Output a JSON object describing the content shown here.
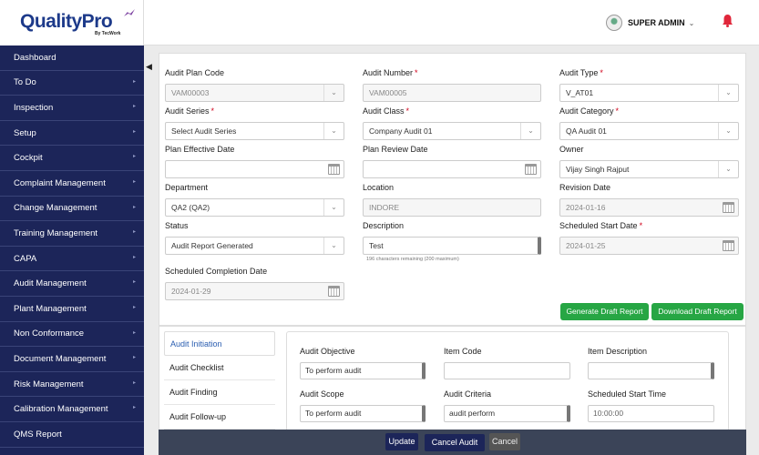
{
  "brand": {
    "name": "QualityPro",
    "tagline": "By TecWork"
  },
  "header": {
    "user": "SUPER ADMIN",
    "caret": "⌄"
  },
  "icons": {
    "bell": "bell-icon",
    "avatar": "avatar-icon",
    "collapse": "collapse-left-icon",
    "calendar": "calendar-icon",
    "chevron": "chevron-down-icon"
  },
  "colors": {
    "sidebar": "#1c2559",
    "accent": "#27a644",
    "required": "#d0021b"
  },
  "sidebar": {
    "collapse": "◀",
    "items": [
      {
        "label": "Dashboard",
        "arrow": ""
      },
      {
        "label": "To Do",
        "arrow": "▸"
      },
      {
        "label": "Inspection",
        "arrow": "▸"
      },
      {
        "label": "Setup",
        "arrow": "▸"
      },
      {
        "label": "Cockpit",
        "arrow": "▸"
      },
      {
        "label": "Complaint Management",
        "arrow": "▸"
      },
      {
        "label": "Change Management",
        "arrow": "▸"
      },
      {
        "label": "Training Management",
        "arrow": "▸"
      },
      {
        "label": "CAPA",
        "arrow": "▸"
      },
      {
        "label": "Audit Management",
        "arrow": "▸"
      },
      {
        "label": "Plant Management",
        "arrow": "▸"
      },
      {
        "label": "Non Conformance",
        "arrow": "▸"
      },
      {
        "label": "Document Management",
        "arrow": "▸"
      },
      {
        "label": "Risk Management",
        "arrow": "▸"
      },
      {
        "label": "Calibration Management",
        "arrow": "▸"
      },
      {
        "label": "QMS Report",
        "arrow": ""
      }
    ]
  },
  "form": {
    "audit_plan_code": {
      "label": "Audit Plan Code",
      "value": "VAM00003"
    },
    "audit_number": {
      "label": "Audit Number",
      "value": "VAM00005"
    },
    "audit_type": {
      "label": "Audit Type",
      "value": "V_AT01"
    },
    "audit_series": {
      "label": "Audit Series",
      "value": "Select Audit Series"
    },
    "audit_class": {
      "label": "Audit Class",
      "value": "Company Audit 01"
    },
    "audit_category": {
      "label": "Audit Category",
      "value": "QA Audit 01"
    },
    "plan_effective_date": {
      "label": "Plan Effective Date",
      "value": ""
    },
    "plan_review_date": {
      "label": "Plan Review Date",
      "value": ""
    },
    "owner": {
      "label": "Owner",
      "value": "Vijay Singh Rajput"
    },
    "department": {
      "label": "Department",
      "value": "QA2 (QA2)"
    },
    "location": {
      "label": "Location",
      "value": "INDORE"
    },
    "revision_date": {
      "label": "Revision Date",
      "value": "2024-01-16"
    },
    "status": {
      "label": "Status",
      "value": "Audit Report Generated"
    },
    "description": {
      "label": "Description",
      "value": "Test",
      "hint": "196 characters remaining (200 maximum)"
    },
    "scheduled_start_date": {
      "label": "Scheduled Start Date",
      "value": "2024-01-25"
    },
    "scheduled_completion_date": {
      "label": "Scheduled Completion Date",
      "value": "2024-01-29"
    },
    "required_mark": "*"
  },
  "actions": {
    "generate_draft": "Generate Draft Report",
    "download_draft": "Download Draft Report"
  },
  "tabs": [
    "Audit Initiation",
    "Audit Checklist",
    "Audit Finding",
    "Audit Follow-up"
  ],
  "initiation": {
    "audit_objective": {
      "label": "Audit Objective",
      "value": "To perform audit"
    },
    "item_code": {
      "label": "Item Code",
      "value": ""
    },
    "item_description": {
      "label": "Item Description",
      "value": ""
    },
    "audit_scope": {
      "label": "Audit Scope",
      "value": "To perform audit"
    },
    "audit_criteria": {
      "label": "Audit Criteria",
      "value": "audit perform"
    },
    "scheduled_start_time": {
      "label": "Scheduled Start Time",
      "value": "10:00:00"
    }
  },
  "footer": {
    "update": "Update",
    "cancel_audit": "Cancel Audit",
    "cancel": "Cancel"
  }
}
